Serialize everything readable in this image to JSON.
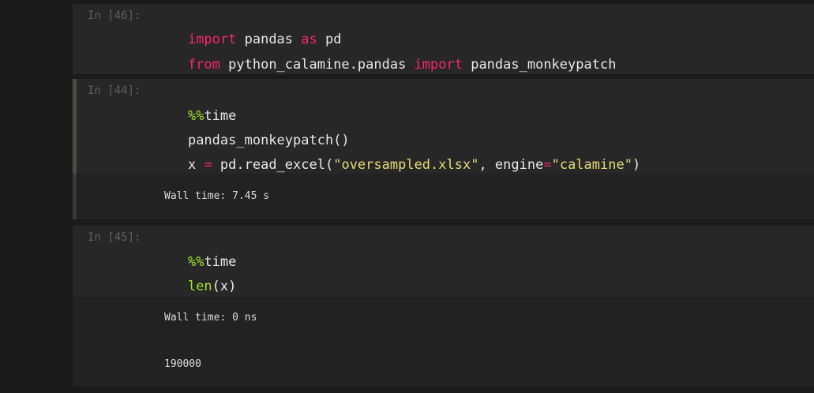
{
  "cells": [
    {
      "prompt": "In [46]:",
      "lines": [
        [
          {
            "t": "kw",
            "v": "import"
          },
          {
            "t": "plain",
            "v": " pandas "
          },
          {
            "t": "kw",
            "v": "as"
          },
          {
            "t": "plain",
            "v": " pd"
          }
        ],
        [
          {
            "t": "kw",
            "v": "from"
          },
          {
            "t": "plain",
            "v": " python_calamine.pandas "
          },
          {
            "t": "kw",
            "v": "import"
          },
          {
            "t": "plain",
            "v": " pandas_monkeypatch"
          }
        ]
      ]
    },
    {
      "prompt": "In [44]:",
      "lines": [
        [
          {
            "t": "magic",
            "v": "%%"
          },
          {
            "t": "plain",
            "v": "time"
          }
        ],
        [
          {
            "t": "plain",
            "v": "pandas_monkeypatch()"
          }
        ],
        [
          {
            "t": "plain",
            "v": "x "
          },
          {
            "t": "kw",
            "v": "="
          },
          {
            "t": "plain",
            "v": " pd.read_excel("
          },
          {
            "t": "str",
            "v": "\"oversampled.xlsx\""
          },
          {
            "t": "plain",
            "v": ", engine"
          },
          {
            "t": "kw",
            "v": "="
          },
          {
            "t": "str",
            "v": "\"calamine\""
          },
          {
            "t": "plain",
            "v": ")"
          }
        ]
      ],
      "outputs": [
        "Wall time: 7.45 s"
      ]
    },
    {
      "prompt": "In [45]:",
      "lines": [
        [
          {
            "t": "magic",
            "v": "%%"
          },
          {
            "t": "plain",
            "v": "time"
          }
        ],
        [
          {
            "t": "builtin",
            "v": "len"
          },
          {
            "t": "plain",
            "v": "(x)"
          }
        ]
      ],
      "outputs": [
        "Wall time: 0 ns",
        "190000"
      ]
    }
  ]
}
